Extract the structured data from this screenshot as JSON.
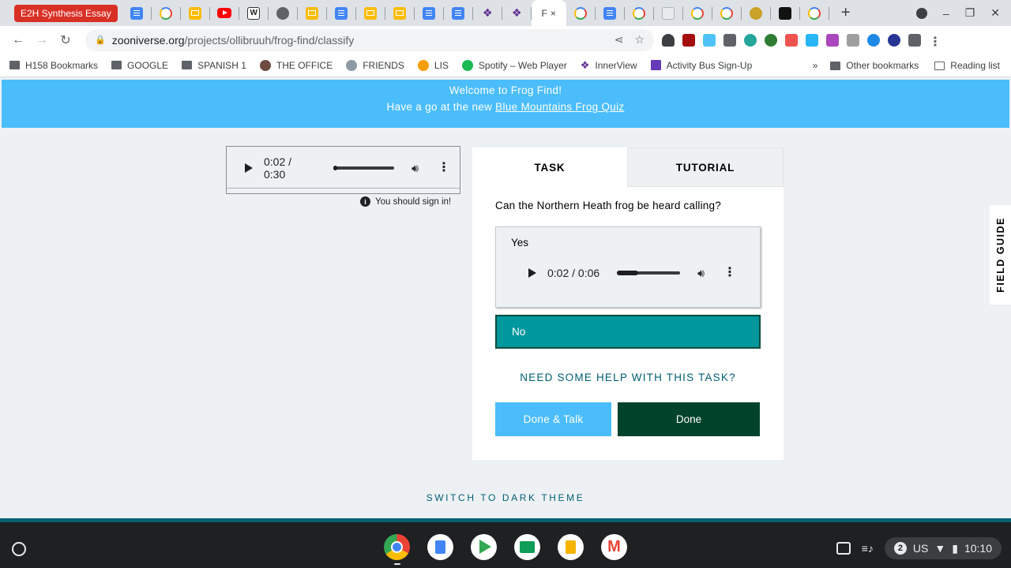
{
  "browser": {
    "tabs": {
      "first_tab_label": "E2H Synthesis Essay",
      "current_tab_label": "F",
      "close_glyph": "×",
      "new_tab_glyph": "+"
    },
    "address": {
      "host": "zooniverse.org",
      "path": "/projects/ollibruuh/frog-find/classify"
    },
    "bookmarks": [
      {
        "label": "H158 Bookmarks",
        "icon": "folder-icon"
      },
      {
        "label": "GOOGLE",
        "icon": "folder-icon"
      },
      {
        "label": "SPANISH 1",
        "icon": "folder-icon"
      },
      {
        "label": "THE OFFICE",
        "icon": "person-icon"
      },
      {
        "label": "FRIENDS",
        "icon": "tv-icon"
      },
      {
        "label": "LIS",
        "icon": "lis-icon"
      },
      {
        "label": "Spotify – Web Player",
        "icon": "spotify-icon"
      },
      {
        "label": "InnerView",
        "icon": "innerview-icon"
      },
      {
        "label": "Activity Bus Sign-Up",
        "icon": "forms-icon"
      }
    ],
    "bookmarks_overflow": "»",
    "other_bookmarks": "Other bookmarks",
    "reading_list": "Reading list"
  },
  "banner": {
    "line1": "Welcome to Frog Find!",
    "line2_prefix": "Have a go at the new ",
    "line2_link": "Blue Mountains Frog Quiz"
  },
  "subject": {
    "audio_time": "0:02 / 0:30",
    "audio_progress": 0.07,
    "signin_notice": "You should sign in!"
  },
  "task_panel": {
    "tab_task": "TASK",
    "tab_tutorial": "TUTORIAL",
    "question": "Can the Northern Heath frog be heard calling?",
    "answers": [
      {
        "label": "Yes",
        "audio_time": "0:02 / 0:06",
        "audio_progress": 0.33
      },
      {
        "label": "No",
        "selected": true
      }
    ],
    "help_link": "NEED SOME HELP WITH THIS TASK?",
    "done_talk": "Done & Talk",
    "done": "Done"
  },
  "field_guide": "FIELD GUIDE",
  "switch_theme": "SWITCH TO DARK THEME",
  "shelf": {
    "apps": [
      "chrome-icon",
      "docs-icon",
      "play-store-icon",
      "classroom-icon",
      "slides-icon",
      "gmail-icon"
    ],
    "notification_count": "2",
    "input_method": "US",
    "clock": "10:10"
  },
  "colors": {
    "banner": "#4bbdfa",
    "selected_answer": "#00979d",
    "done_button": "#00432b",
    "done_talk_button": "#4bbdfa",
    "link_teal": "#005f73"
  }
}
